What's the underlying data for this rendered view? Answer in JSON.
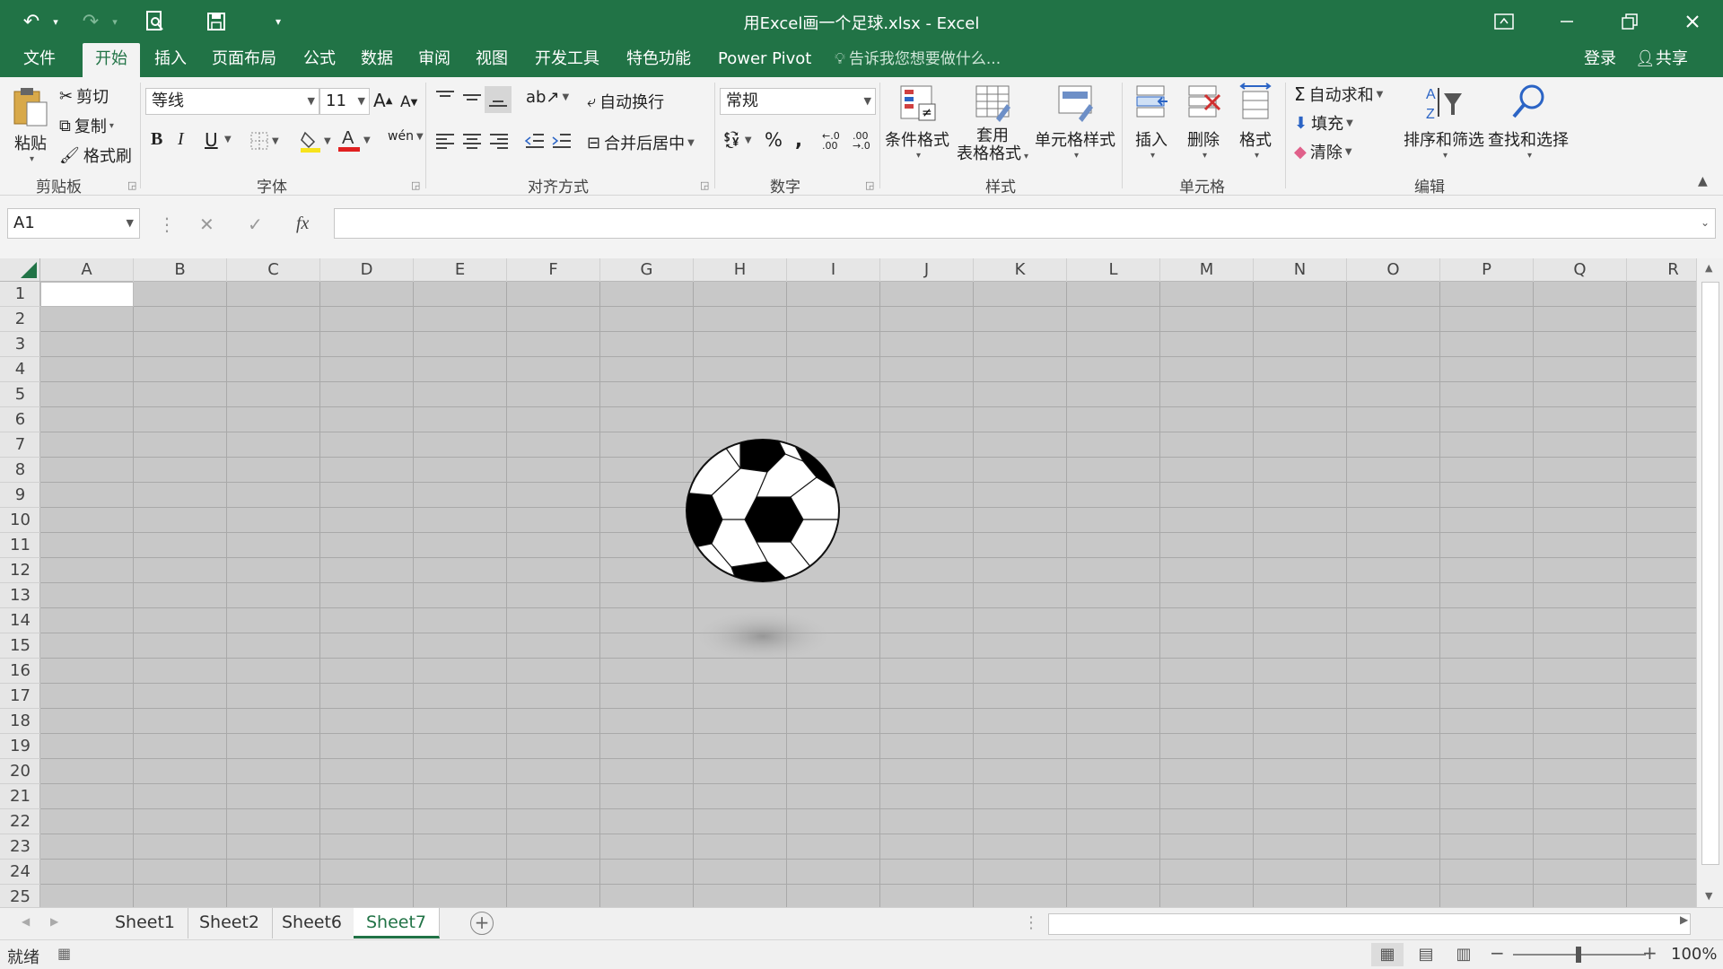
{
  "window": {
    "title": "用Excel画一个足球.xlsx - Excel"
  },
  "tabs": [
    "文件",
    "开始",
    "插入",
    "页面布局",
    "公式",
    "数据",
    "审阅",
    "视图",
    "开发工具",
    "特色功能",
    "Power Pivot"
  ],
  "tell_me": "告诉我您想要做什么...",
  "account": {
    "login": "登录",
    "share": "共享"
  },
  "ribbon": {
    "clipboard": {
      "paste": "粘贴",
      "cut": "剪切",
      "copy": "复制",
      "format_painter": "格式刷",
      "label": "剪贴板"
    },
    "font": {
      "name": "等线",
      "size": "11",
      "bold": "B",
      "italic": "I",
      "underline": "U",
      "phonetic": "wén",
      "label": "字体"
    },
    "alignment": {
      "wrap_text": "自动换行",
      "merge_center": "合并后居中",
      "label": "对齐方式"
    },
    "number": {
      "format": "常规",
      "percent": "%",
      "comma": ",",
      "label": "数字"
    },
    "styles": {
      "conditional": "条件格式",
      "table_line1": "套用",
      "table_line2": "表格格式",
      "cell_styles": "单元格样式",
      "label": "样式"
    },
    "cells": {
      "insert": "插入",
      "delete": "删除",
      "format": "格式",
      "label": "单元格"
    },
    "editing": {
      "autosum": "自动求和",
      "fill": "填充",
      "clear": "清除",
      "sort_filter": "排序和筛选",
      "find_select": "查找和选择",
      "label": "编辑"
    }
  },
  "formula_bar": {
    "name_box": "A1",
    "fx": "fx",
    "value": ""
  },
  "columns": [
    "A",
    "B",
    "C",
    "D",
    "E",
    "F",
    "G",
    "H",
    "I",
    "J",
    "K",
    "L",
    "M",
    "N",
    "O",
    "P",
    "Q",
    "R"
  ],
  "rows": [
    "1",
    "2",
    "3",
    "4",
    "5",
    "6",
    "7",
    "8",
    "9",
    "10",
    "11",
    "12",
    "13",
    "14",
    "15",
    "16",
    "17",
    "18",
    "19",
    "20",
    "21",
    "22",
    "23",
    "24",
    "25"
  ],
  "sheets": [
    {
      "name": "Sheet1",
      "active": false
    },
    {
      "name": "Sheet2",
      "active": false
    },
    {
      "name": "Sheet6",
      "active": false
    },
    {
      "name": "Sheet7",
      "active": true
    }
  ],
  "status": {
    "ready": "就绪",
    "zoom": "100%"
  },
  "colors": {
    "accent": "#217346",
    "sheet_bg": "#c8c8c8"
  }
}
